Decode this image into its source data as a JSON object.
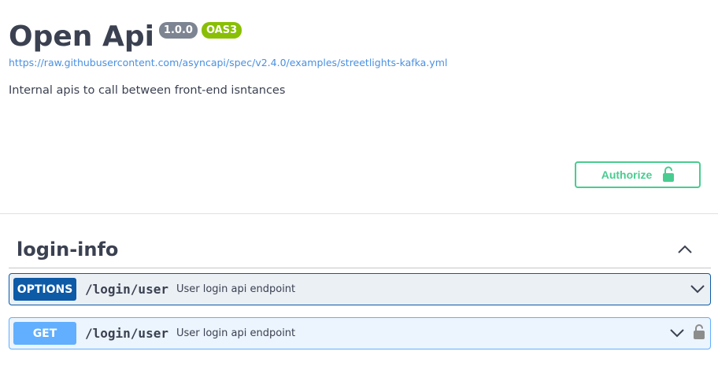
{
  "info": {
    "title": "Open Api",
    "version": "1.0.0",
    "oas_badge": "OAS3",
    "spec_url": "https://raw.githubusercontent.com/asyncapi/spec/v2.4.0/examples/streetlights-kafka.yml",
    "description": "Internal apis to call between front-end isntances"
  },
  "auth": {
    "button_label": "Authorize",
    "icon": "unlocked-lock-icon"
  },
  "tag": {
    "name": "login-info",
    "toggle_icon": "chevron-up-icon"
  },
  "operations": [
    {
      "method": "OPTIONS",
      "path": "/login/user",
      "summary": "User login api endpoint",
      "color": "#0d5aa7",
      "locked": false
    },
    {
      "method": "GET",
      "path": "/login/user",
      "summary": "User login api endpoint",
      "color": "#61affe",
      "locked": true
    }
  ],
  "colors": {
    "accent": "#49cc90",
    "options": "#0d5aa7",
    "get": "#61affe",
    "version_badge": "#7d8492",
    "oas_badge": "#89bf04"
  }
}
